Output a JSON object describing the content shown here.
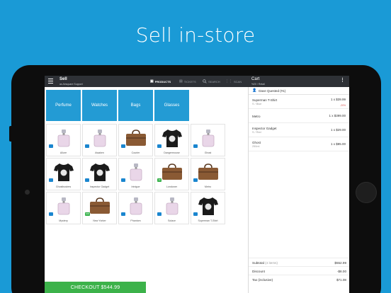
{
  "headline": "Sell in-store",
  "sell": {
    "title": "Sell",
    "subtitle": "as Airsquare Support"
  },
  "nav": {
    "products": "PRODUCTS",
    "tickets": "TICKETS",
    "search": "SEARCH",
    "scan": "SCAN"
  },
  "categories": [
    "Perfume",
    "Watches",
    "Bags",
    "Glasses"
  ],
  "products": [
    {
      "name": "Allure",
      "badge": "",
      "icon": "perfume-bottle-icon"
    },
    {
      "name": "Awaken",
      "badge": "",
      "icon": "perfume-bottle-icon"
    },
    {
      "name": "Courier",
      "badge": "",
      "icon": "leather-bag-icon"
    },
    {
      "name": "Dangermouse",
      "badge": "",
      "icon": "tshirt-icon"
    },
    {
      "name": "Ghost",
      "badge": "",
      "icon": "perfume-bottle-icon"
    },
    {
      "name": "Ghostbusters",
      "badge": "",
      "icon": "tshirt-icon"
    },
    {
      "name": "Inspector Gadget",
      "badge": "",
      "icon": "tshirt-icon"
    },
    {
      "name": "Intrigue",
      "badge": "",
      "icon": "perfume-bottle-icon"
    },
    {
      "name": "Londoner",
      "badge": "10",
      "icon": "leather-bag-icon"
    },
    {
      "name": "Metro",
      "badge": "",
      "icon": "leather-bag-icon"
    },
    {
      "name": "Mystery",
      "badge": "",
      "icon": "perfume-bottle-icon"
    },
    {
      "name": "New Yorker",
      "badge": "100",
      "icon": "leather-bag-icon"
    },
    {
      "name": "Phantom",
      "badge": "",
      "icon": "perfume-bottle-icon"
    },
    {
      "name": "Solace",
      "badge": "",
      "icon": "perfume-bottle-icon"
    },
    {
      "name": "Superman T-Shirt",
      "badge": "",
      "icon": "tshirt-icon"
    }
  ],
  "cart": {
    "title": "Cart",
    "subtitle": "%20 / Retail",
    "customer": "Dave Quested (#1)",
    "lines": [
      {
        "name": "Superman T-Shirt",
        "variant": "S / Blue",
        "qty": "1 x $39.99",
        "discount": "-20%"
      },
      {
        "name": "Metro",
        "variant": "",
        "qty": "1 x $399.00",
        "discount": ""
      },
      {
        "name": "Inspector Gadget",
        "variant": "S / Red",
        "qty": "1 x $29.00",
        "discount": ""
      },
      {
        "name": "Ghost",
        "variant": "250ml",
        "qty": "1 x $85.00",
        "discount": ""
      }
    ],
    "subtotal_label": "Subtotal",
    "subtotal_items": "(4 items)",
    "subtotal_value": "$552.99",
    "discount_label": "Discount",
    "discount_value": "-$8.00",
    "tax_label": "Tax (inclusive)",
    "tax_value": "$71.08",
    "checkout": "CHECKOUT $544.99"
  },
  "colors": {
    "brand": "#1a9ad6",
    "category": "#239bd4",
    "checkout": "#3cb24a",
    "topbar": "#2e3136"
  }
}
